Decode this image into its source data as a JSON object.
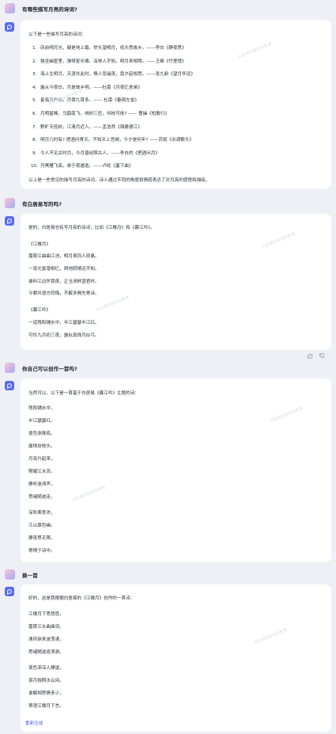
{
  "conversation": [
    {
      "question": "有哪些描写月亮的诗词?",
      "intro": "以下是一些描写月亮的诗词：",
      "list": [
        "床前明月光，疑是地上霜。举头望明月，低头思故乡。——李白《静夜思》",
        "独坐幽篁里，弹琴复长啸。深林人不知，明月来相照。——王维《竹里馆》",
        "海上生明月，天涯共此时。情人怨遥夜，竟夕起相思。——张九龄《望月怀远》",
        "露从今夜白，月是故乡明。——杜甫《月夜忆舍弟》",
        "星临万户动，月傍九霄多。—— 杜甫《春宿左省》",
        "月明星稀，乌鹊南飞。绕树三匝，何枝可依? —— 曹操《短歌行》",
        "野旷天低树，江清月近人。——孟浩然《宿建德江》",
        "明月几时有? 把酒问青天。不知天上宫阙，今夕是何年? ——苏轼《水调歌头》",
        "今人不见古时月，今月曾经照古人。——李白的《把酒问月》",
        "月黑雁飞高，单于夜遁逃。——卢纶《塞下曲》"
      ],
      "summary": "以上是一些常见的描写月亮的诗词，诗人通过不同的角度和情感表达了对月亮的感悟和描绘。"
    },
    {
      "question": "有白居易写的吗?",
      "intro": "是的，白居易也有写月亮的诗词，比如《江楼月》和《暮江吟》。",
      "poem1_title": "《江楼月》",
      "poem1": [
        "嘉陵江曲曲江池，明月虽同人别离。",
        "一宵光景潜相忆，两地阴晴远不知。",
        "谁料江边怀我夜，正当池畔望君时。",
        "今朝共语方同悔，不解多情先寄诗。"
      ],
      "poem2_title": "《暮江吟》",
      "poem2": [
        "一道残阳铺水中，半江瑟瑟半江红。",
        "可怜九月初三夜，露似真珠月似弓。"
      ]
    },
    {
      "question": "你自己可以创作一首吗?",
      "intro": "当然可以。以下是一首基于白居易《暮江吟》主题的诗：",
      "lines": [
        "残阳铺水中，",
        "半江瑟瑟红。",
        "夜色渐降临，",
        "露珠挂枝头。",
        "月亮升起来，",
        "照耀江水流。",
        "静听波涛声，",
        "思绪随波走。",
        "深秋寒意浓，",
        "江山景色幽。",
        "静夜思无限，",
        "寄情于诗中。"
      ]
    },
    {
      "question": "换一首",
      "intro": "好的，这是我根据白居易的《江楼月》创作的一首诗：",
      "lines": [
        "江楼月下思悠悠，",
        "嘉陵江水曲曲流。",
        "清风徐来波荡漾，",
        "思绪随波逐浪游。",
        "夜色渐深人静谧，",
        "孤月独照水云间。",
        "谁解相思情多少，",
        "寄语江楼月下言。"
      ]
    }
  ],
  "regenerate_label": "重新生成",
  "watermark_text": "AI生成内容仅供参考",
  "colors": {
    "accent": "#5b6cf0",
    "background": "#eef0f6",
    "card": "#ffffff"
  }
}
